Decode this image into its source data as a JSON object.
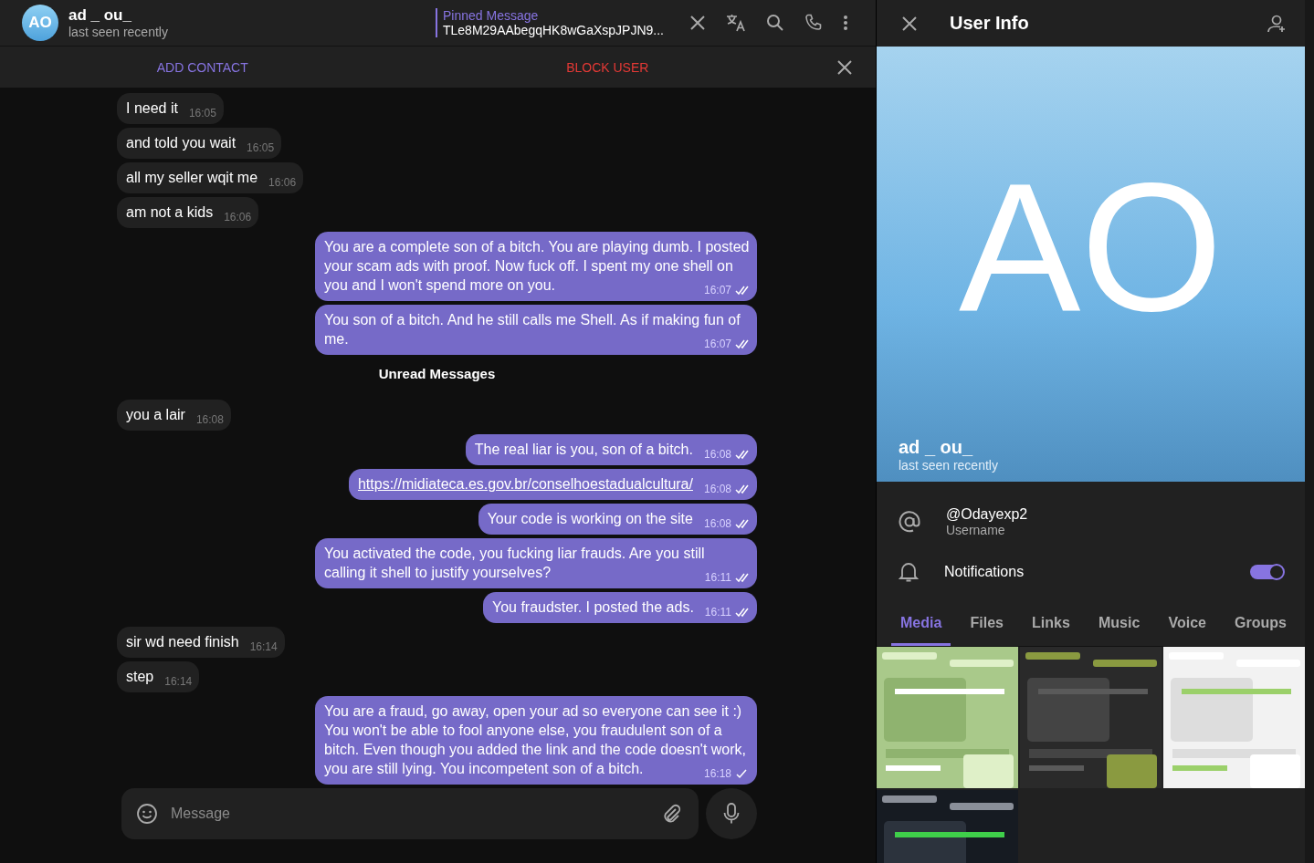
{
  "chat_header": {
    "avatar_initials": "AO",
    "name": "ad _ ou_",
    "status": "last seen recently",
    "pinned": {
      "label": "Pinned Message",
      "text": "TLe8M29AAbegqHK8wGaXspJPJN9..."
    }
  },
  "action_bar": {
    "add_contact": "ADD CONTACT",
    "block_user": "BLOCK USER"
  },
  "messages": [
    {
      "kind": "incoming",
      "text": "I need it",
      "time": "16:05"
    },
    {
      "kind": "incoming",
      "text": "and told you wait",
      "time": "16:05"
    },
    {
      "kind": "incoming",
      "text": "all my seller wqit me",
      "time": "16:06"
    },
    {
      "kind": "incoming",
      "text": "am not a kids",
      "time": "16:06"
    },
    {
      "kind": "outgoing",
      "text": "You are a complete son of a bitch. You are playing dumb. I posted your scam ads with proof. Now fuck off. I spent my one shell on you and I won't spend more on you.",
      "time": "16:07",
      "read": true
    },
    {
      "kind": "outgoing",
      "text": "You son of a bitch. And he still calls me Shell. As if making fun of me.",
      "time": "16:07",
      "read": true
    },
    {
      "kind": "divider",
      "text": "Unread Messages"
    },
    {
      "kind": "incoming",
      "text": "you a lair",
      "time": "16:08"
    },
    {
      "kind": "outgoing",
      "text": "The real liar is you, son of a bitch.",
      "time": "16:08",
      "read": true
    },
    {
      "kind": "link",
      "text": "https://midiateca.es.gov.br/conselhoestadualcultura/",
      "time": "16:08",
      "read": true
    },
    {
      "kind": "outgoing",
      "text": "Your code is working on the site",
      "time": "16:08",
      "read": true
    },
    {
      "kind": "outgoing",
      "text": "You activated the code, you fucking liar frauds. Are you still calling it shell to justify yourselves?",
      "time": "16:11",
      "read": true
    },
    {
      "kind": "outgoing",
      "text": "You fraudster. I posted the ads.",
      "time": "16:11",
      "read": true
    },
    {
      "kind": "incoming",
      "text": "sir wd need finish",
      "time": "16:14"
    },
    {
      "kind": "incoming",
      "text": "step",
      "time": "16:14"
    },
    {
      "kind": "outgoing",
      "text": "You are a fraud, go away, open your ad so everyone can see it :) You won't be able to fool anyone else, you fraudulent son of a bitch. Even though you added the link and the code doesn't work, you are still lying. You incompetent son of a bitch.",
      "time": "16:18",
      "read": false
    }
  ],
  "composer": {
    "placeholder": "Message"
  },
  "user_info": {
    "title": "User Info",
    "avatar_initials": "AO",
    "name": "ad _ ou_",
    "status": "last seen recently",
    "username": {
      "value": "@Odayexp2",
      "label": "Username"
    },
    "notifications": {
      "label": "Notifications",
      "on": true
    },
    "tabs": [
      {
        "label": "Media",
        "selected": true
      },
      {
        "label": "Files",
        "selected": false
      },
      {
        "label": "Links",
        "selected": false
      },
      {
        "label": "Music",
        "selected": false
      },
      {
        "label": "Voice",
        "selected": false
      },
      {
        "label": "Groups",
        "selected": false
      }
    ]
  }
}
